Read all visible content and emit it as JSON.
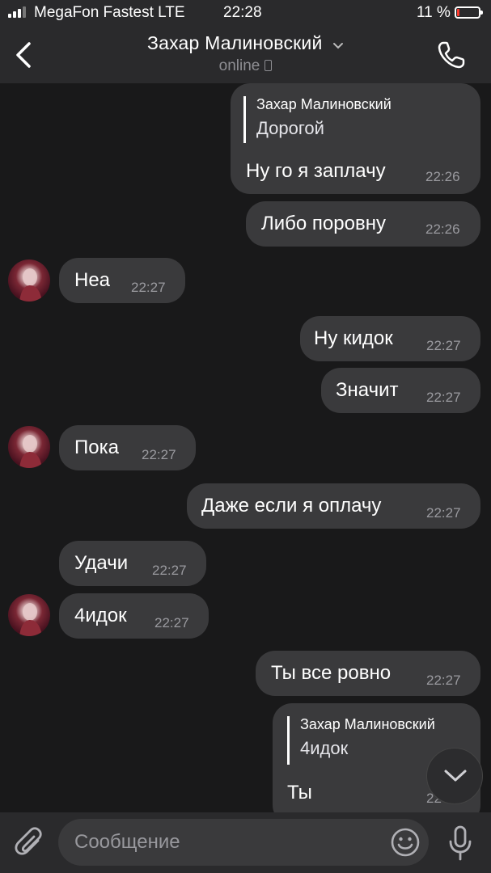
{
  "status_bar": {
    "carrier": "MegaFon Fastest LTE",
    "time": "22:28",
    "battery_percent": "11 %",
    "battery_level": 0.11,
    "signal_bars_active": 3,
    "signal_bars_total": 4,
    "battery_color": "#ff3b30"
  },
  "header": {
    "contact_name": "Захар Малиновский",
    "status": "online",
    "back_icon": "chevron-left-icon",
    "call_icon": "phone-icon",
    "device_icon": "mobile-device-icon"
  },
  "messages": [
    {
      "side": "out",
      "reply_name": "Захар Малиновский",
      "reply_text": "Дорогой",
      "text": "Ну го я заплачу",
      "time": "22:26"
    },
    {
      "side": "out",
      "text": "Либо поровну",
      "time": "22:26"
    },
    {
      "side": "in",
      "text": "Неа",
      "time": "22:27",
      "avatar": true
    },
    {
      "side": "out",
      "text": "Ну кидок",
      "time": "22:27"
    },
    {
      "side": "out",
      "text": "Значит",
      "time": "22:27"
    },
    {
      "side": "in",
      "text": "Пока",
      "time": "22:27",
      "avatar": true
    },
    {
      "side": "out",
      "text": "Даже если я оплачу",
      "time": "22:27"
    },
    {
      "side": "in",
      "text": "Удачи",
      "time": "22:27"
    },
    {
      "side": "in",
      "text": "4идок",
      "time": "22:27",
      "avatar": true
    },
    {
      "side": "out",
      "text": "Ты все ровно",
      "time": "22:27"
    },
    {
      "side": "out",
      "reply_name": "Захар Малиновский",
      "reply_text": "4идок",
      "text": "Ты",
      "time": "22"
    }
  ],
  "scroll_down_icon": "chevron-down-icon",
  "input_bar": {
    "placeholder": "Сообщение",
    "value": "",
    "attach_icon": "paperclip-icon",
    "emoji_icon": "emoji-icon",
    "mic_icon": "microphone-icon"
  },
  "colors": {
    "background": "#19191a",
    "bar": "#2a2a2c",
    "bubble": "#3a3a3c",
    "secondary_text": "#8e8e93"
  }
}
